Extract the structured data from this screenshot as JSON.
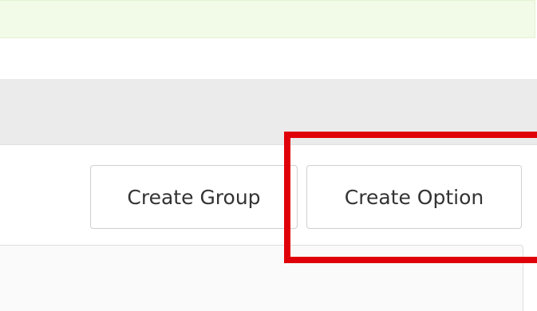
{
  "toolbar": {
    "create_group_label": "Create Group",
    "create_option_label": "Create Option"
  },
  "colors": {
    "success_bar": "#f1fbe7",
    "section_header": "#ebebeb",
    "button_border": "#cfcfcf",
    "button_text": "#333333",
    "highlight": "#e0000a"
  }
}
